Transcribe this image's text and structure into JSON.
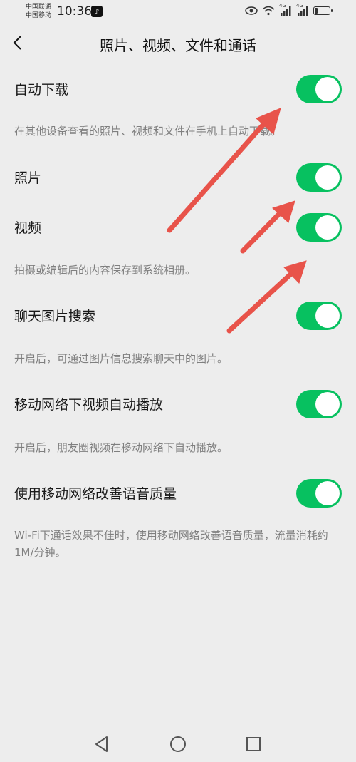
{
  "status_bar": {
    "carrier1": "中国联通",
    "carrier2": "中国移动",
    "time": "10:36",
    "network1": "4G",
    "network2": "4G",
    "battery_level": 0.2
  },
  "header": {
    "title": "照片、视频、文件和通话"
  },
  "settings": [
    {
      "label": "自动下载",
      "enabled": true
    },
    {
      "desc": "在其他设备查看的照片、视频和文件在手机上自动下载。"
    },
    {
      "label": "照片",
      "enabled": true
    },
    {
      "label": "视频",
      "enabled": true
    },
    {
      "desc": "拍摄或编辑后的内容保存到系统相册。"
    },
    {
      "label": "聊天图片搜索",
      "enabled": true
    },
    {
      "desc": "开启后，可通过图片信息搜索聊天中的图片。"
    },
    {
      "label": "移动网络下视频自动播放",
      "enabled": true
    },
    {
      "desc": "开启后，朋友圈视频在移动网络下自动播放。"
    },
    {
      "label": "使用移动网络改善语音质量",
      "enabled": true
    },
    {
      "desc": "Wi-Fi下通话效果不佳时，使用移动网络改善语音质量，流量消耗约1M/分钟。"
    }
  ],
  "colors": {
    "toggle_on": "#07c160",
    "annotation_arrow": "#e8534a",
    "background": "#ededed"
  }
}
